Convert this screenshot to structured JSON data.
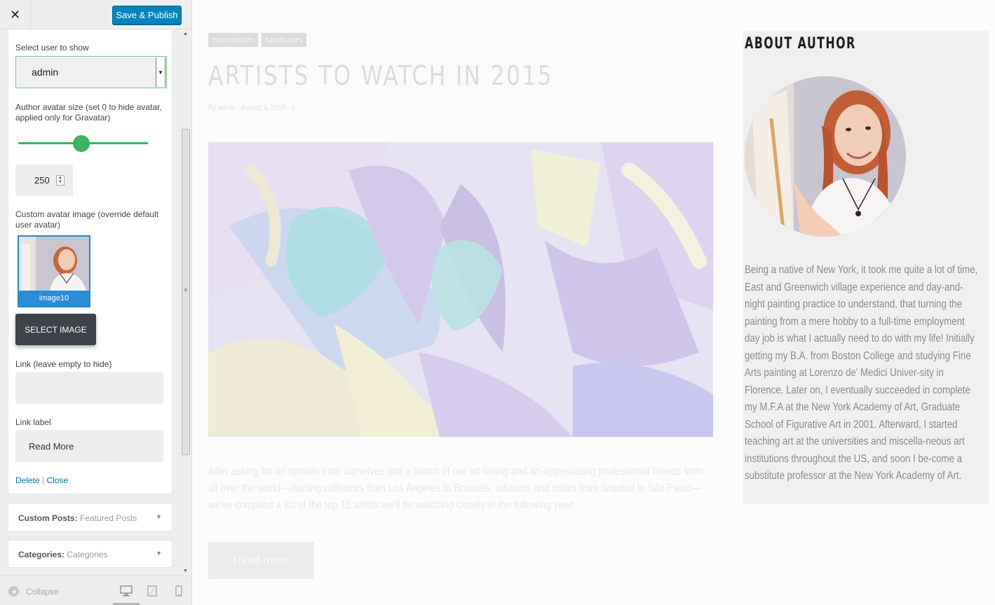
{
  "customizer": {
    "close_glyph": "✕",
    "save_label": "Save & Publish",
    "widget": {
      "user_label": "Select user to show",
      "user_value": "admin",
      "size_label": "Author avatar size (set 0 to hide avatar, applied only for Gravatar)",
      "size_value": "250",
      "avatar_label": "Custom avatar image (override default user avatar)",
      "avatar_caption": "image10",
      "select_image_label": "SELECT IMAGE",
      "link_label": "Link (leave empty to hide)",
      "link_value": "",
      "link_text_label": "Link label",
      "link_text_value": "Read More",
      "delete_label": "Delete",
      "separator": "|",
      "close_label": "Close"
    },
    "sections": [
      {
        "title": "Custom Posts:",
        "subtitle": "Featured Posts"
      },
      {
        "title": "Categories:",
        "subtitle": "Categories"
      }
    ],
    "footer": {
      "collapse_label": "Collapse",
      "devices": [
        "desktop-icon",
        "tablet-icon",
        "mobile-icon"
      ]
    }
  },
  "preview": {
    "tags": [
      "Hyperrealism",
      "Landscapes"
    ],
    "title": "ARTISTS TO WATCH IN 2015",
    "meta": "By admin - August 9, 2016 - 3",
    "excerpt": "After asking for an opinion from ourselves and a bunch of our art-loving and art-appreciating professional friends from all over the world—starting collectors from Los Angeles to Brussels, advisors and critics from Istanbul to São Paulo—we've compiled a list of the top 15 artists we'll be watching closely in the following year!",
    "read_more": "Read more",
    "about": {
      "title": "ABOUT AUTHOR",
      "bio": "Being a native of New York, it took me quite a lot of time, East and Greenwich village experience and day-and-night painting practice to understand, that turning the painting from a mere hobby to a full-time employment day job is what I actually need to do with my life! Initially getting my B.A. from Boston College and studying Fine Arts painting at Lorenzo de' Medici Univer-sity in Florence. Later on, I eventually succeeded in complete my M.F.A at the New York Academy of Art, Graduate School of Figurative Art in 2001. Afterward, I started teaching art at the universities and miscella-neous art institutions throughout the US, and soon I be-come a substitute professor at the New York Academy of Art."
    }
  },
  "colors": {
    "primary_button": "#0085ba",
    "slider": "#3cb55e",
    "select_image_button": "#3e434a",
    "link": "#0073aa",
    "thumbnail_caption": "#2d8cd6"
  }
}
